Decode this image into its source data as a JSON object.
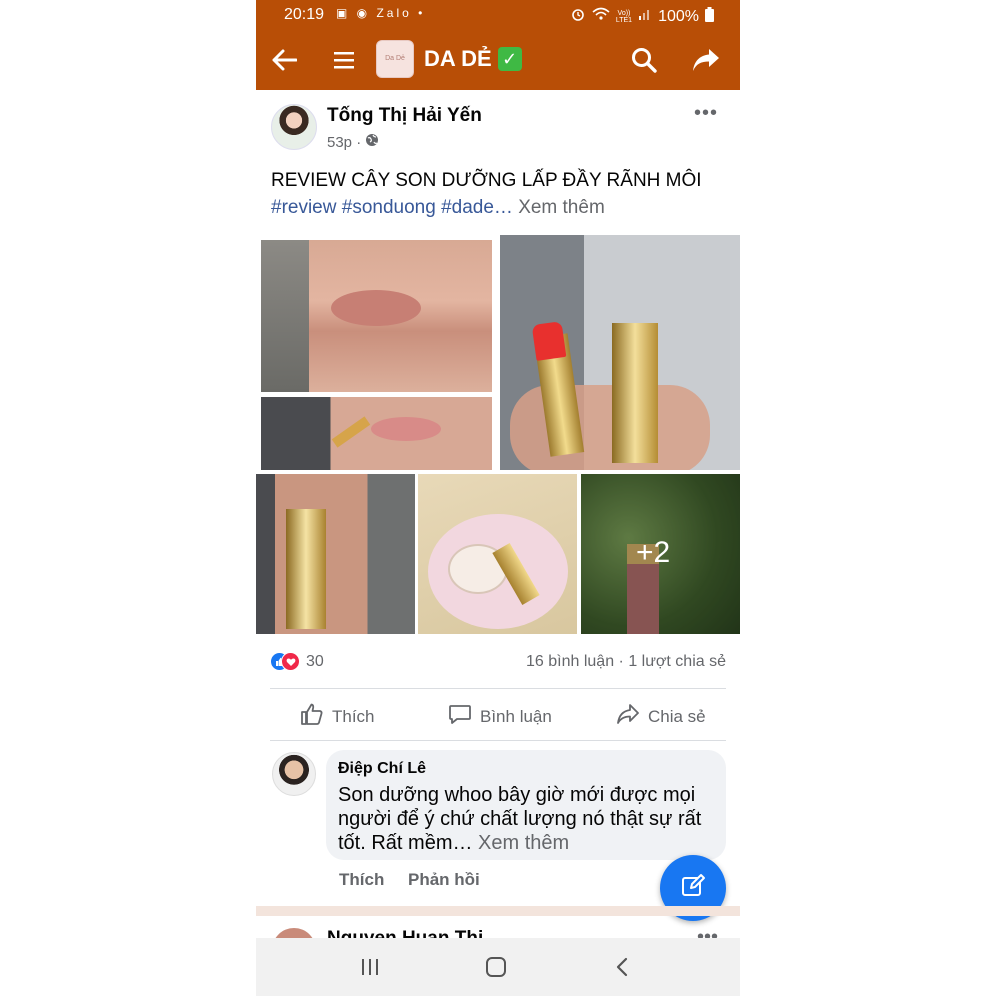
{
  "status_bar": {
    "time": "20:19",
    "notification_icons": "▣ ◉ Zalo •",
    "volte_top": "Vo))",
    "volte_bottom": "LTE1",
    "battery": "100%"
  },
  "app_bar": {
    "logo_text": "Da Dẻ",
    "title": "DA DẺ",
    "verified_mark": "✓"
  },
  "post": {
    "author": "Tống Thị Hải Yến",
    "time": "53p ·",
    "text": "REVIEW CÂY SON DƯỠNG LẤP ĐẦY RÃNH MÔI",
    "tags": "#review #sonduong #dade…",
    "see_more": "Xem thêm",
    "extra_photos": "+2",
    "reaction_count": "30",
    "counts": "16 bình luận · 1 lượt chia sẻ"
  },
  "actions": {
    "like": "Thích",
    "comment": "Bình luận",
    "share": "Chia sẻ"
  },
  "comment": {
    "name": "Điệp Chí Lê",
    "text": "Son dưỡng whoo bây giờ mới được mọi người để ý chứ chất lượng nó thật sự rất tốt. Rất mềm…",
    "see_more": "Xem thêm",
    "like": "Thích",
    "reply": "Phản hồi"
  },
  "next_post": {
    "author": "Nguyen Huan Thi"
  },
  "colors": {
    "app_bar": "#b84e06",
    "link": "#385898",
    "accent": "#1877f2",
    "love": "#f02849"
  },
  "icons": [
    "back-arrow-icon",
    "menu-icon",
    "search-icon",
    "share-icon",
    "globe-icon",
    "more-icon",
    "like-icon",
    "comment-icon",
    "share-action-icon",
    "compose-icon",
    "recents-icon",
    "home-icon",
    "back-nav-icon"
  ]
}
